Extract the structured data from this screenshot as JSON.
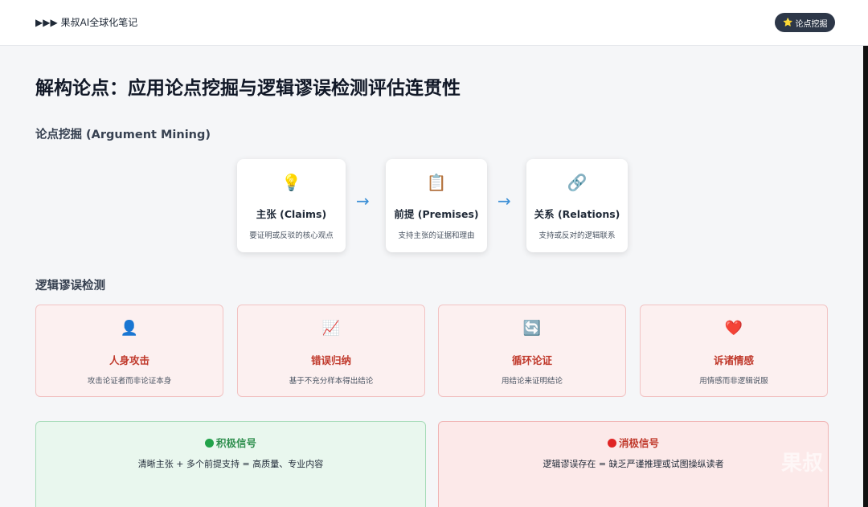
{
  "header": {
    "brand": "▶▶▶ 果叔AI全球化笔记",
    "pill_icon": "⭐",
    "pill_label": "论点挖掘"
  },
  "page": {
    "title": "解构论点：应用论点挖掘与逻辑谬误检测评估连贯性"
  },
  "argument_mining": {
    "section_title": "论点挖掘 (Argument Mining)",
    "steps": [
      {
        "icon": "💡",
        "icon_name": "lightbulb-icon",
        "title": "主张 (Claims)",
        "desc": "要证明或反驳的核心观点"
      },
      {
        "icon": "📋",
        "icon_name": "clipboard-icon",
        "title": "前提 (Premises)",
        "desc": "支持主张的证据和理由"
      },
      {
        "icon": "🔗",
        "icon_name": "link-icon",
        "title": "关系 (Relations)",
        "desc": "支持或反对的逻辑联系"
      }
    ],
    "arrow": "→"
  },
  "fallacy_detection": {
    "section_title": "逻辑谬误检测",
    "items": [
      {
        "icon": "👤",
        "icon_name": "person-icon",
        "title": "人身攻击",
        "desc": "攻击论证者而非论证本身"
      },
      {
        "icon": "📈",
        "icon_name": "chart-up-icon",
        "title": "错误归纳",
        "desc": "基于不充分样本得出结论"
      },
      {
        "icon": "🔄",
        "icon_name": "cycle-icon",
        "title": "循环论证",
        "desc": "用结论来证明结论"
      },
      {
        "icon": "❤️",
        "icon_name": "heart-icon",
        "title": "诉诸情感",
        "desc": "用情感而非逻辑说服"
      }
    ]
  },
  "signals": {
    "positive": {
      "title": "积极信号",
      "text": "清晰主张 + 多个前提支持 = 高质量、专业内容",
      "color": "#2f8f4e"
    },
    "negative": {
      "title": "消极信号",
      "text": "逻辑谬误存在 = 缺乏严谨推理或试图操纵读者",
      "color": "#c0392b"
    }
  },
  "watermark": "果叔"
}
